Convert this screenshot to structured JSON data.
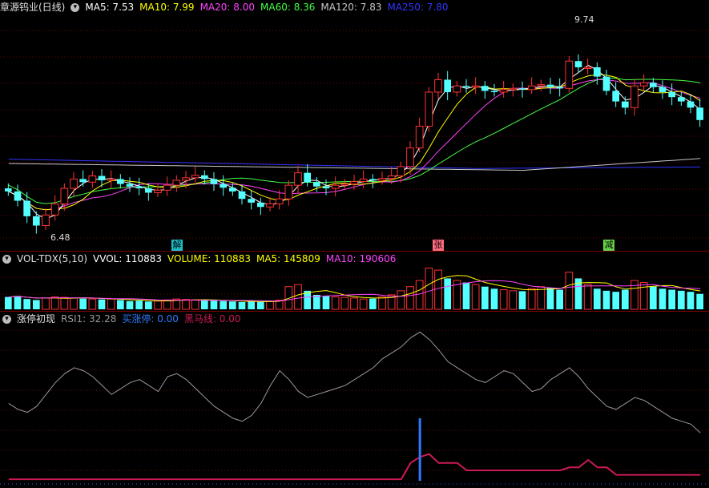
{
  "main": {
    "title": "章源钨业(日线)",
    "ma": [
      {
        "text": "MA5: 7.53",
        "color": "#ffffff"
      },
      {
        "text": "MA10: 7.99",
        "color": "#ffff00"
      },
      {
        "text": "MA20: 8.00",
        "color": "#ff44ff"
      },
      {
        "text": "MA60: 8.36",
        "color": "#44ff44"
      },
      {
        "text": "MA120: 7.83",
        "color": "#c8c8c8"
      },
      {
        "text": "MA250: 7.80",
        "color": "#3333ff"
      }
    ],
    "high_label": "9.74",
    "low_label": "6.48",
    "events": [
      {
        "label": "解",
        "color": "#1fbfc8"
      },
      {
        "label": "张",
        "color": "#ff6c80"
      },
      {
        "label": "减",
        "color": "#66d24a"
      }
    ]
  },
  "volume": {
    "name": "VOL-TDX(5,10)",
    "fields": [
      {
        "text": "VVOL: 110883"
      },
      {
        "text": "VOLUME: 110883"
      },
      {
        "text": "MA5: 145809"
      },
      {
        "text": "MA10: 190606"
      }
    ]
  },
  "indicator": {
    "name": "涨停初现",
    "fields": [
      {
        "text": "RSI1: 32.28"
      },
      {
        "text": "买涨停: 0.00"
      },
      {
        "text": "黑马线: 0.00"
      }
    ]
  },
  "colors": {
    "up": "#ff3232",
    "down": "#54ffff",
    "grid": "#7a0000"
  },
  "chart_data": {
    "type": "candlestick",
    "series": [
      {
        "name": "close",
        "values": [
          7.1,
          6.95,
          6.7,
          6.55,
          6.72,
          6.9,
          7.15,
          7.3,
          7.25,
          7.35,
          7.28,
          7.3,
          7.22,
          7.18,
          7.15,
          7.08,
          7.12,
          7.2,
          7.28,
          7.32,
          7.36,
          7.3,
          7.22,
          7.16,
          7.1,
          6.98,
          6.92,
          6.85,
          6.9,
          6.98,
          7.2,
          7.4,
          7.25,
          7.18,
          7.15,
          7.2,
          7.22,
          7.26,
          7.3,
          7.28,
          7.31,
          7.35,
          7.5,
          7.8,
          8.15,
          8.7,
          8.9,
          8.7,
          8.8,
          8.78,
          8.8,
          8.72,
          8.7,
          8.74,
          8.76,
          8.74,
          8.8,
          8.82,
          8.78,
          8.76,
          9.2,
          9.1,
          9.1,
          8.95,
          8.72,
          8.55,
          8.45,
          8.8,
          8.85,
          8.78,
          8.7,
          8.62,
          8.55,
          8.45,
          8.25
        ]
      },
      {
        "name": "volume",
        "values": [
          60,
          65,
          50,
          45,
          55,
          60,
          58,
          55,
          52,
          50,
          48,
          50,
          45,
          40,
          42,
          38,
          40,
          45,
          50,
          48,
          46,
          44,
          42,
          40,
          38,
          35,
          38,
          36,
          40,
          45,
          110,
          120,
          90,
          70,
          65,
          60,
          58,
          55,
          50,
          52,
          60,
          70,
          90,
          110,
          140,
          200,
          190,
          150,
          140,
          130,
          120,
          110,
          100,
          95,
          90,
          88,
          100,
          110,
          105,
          95,
          180,
          150,
          120,
          100,
          90,
          85,
          95,
          140,
          130,
          110,
          100,
          95,
          90,
          85,
          75
        ]
      },
      {
        "name": "RSI1",
        "values": [
          52,
          48,
          46,
          50,
          58,
          66,
          72,
          76,
          74,
          70,
          64,
          58,
          62,
          66,
          68,
          64,
          60,
          70,
          72,
          68,
          62,
          56,
          50,
          46,
          42,
          40,
          44,
          52,
          64,
          74,
          68,
          60,
          56,
          58,
          60,
          62,
          64,
          68,
          72,
          76,
          82,
          86,
          90,
          96,
          100,
          95,
          88,
          80,
          76,
          72,
          68,
          66,
          70,
          74,
          72,
          66,
          60,
          62,
          68,
          72,
          76,
          70,
          62,
          56,
          50,
          48,
          52,
          56,
          54,
          50,
          46,
          42,
          40,
          38,
          32.28
        ]
      }
    ]
  }
}
